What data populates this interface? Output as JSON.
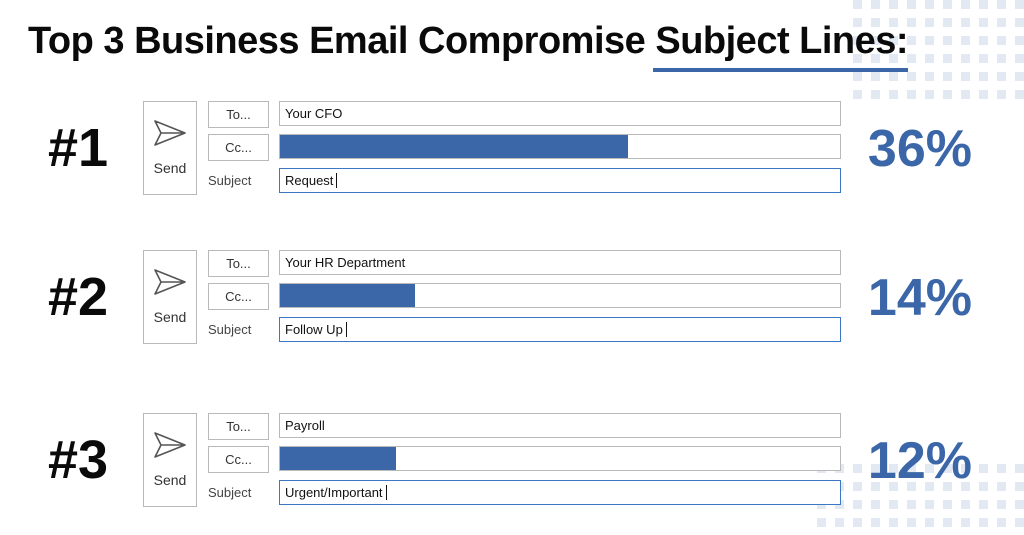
{
  "title": {
    "prefix": "Top 3 Business Email Compromise ",
    "underlined": "Subject Lines:"
  },
  "compose": {
    "send_label": "Send",
    "to_label": "To...",
    "cc_label": "Cc...",
    "subject_label": "Subject"
  },
  "colors": {
    "accent": "#3b67a8",
    "subject_border": "#3b79c4",
    "dots": "#e3e9f3"
  },
  "chart_data": {
    "type": "bar",
    "title": "Top 3 Business Email Compromise Subject Lines:",
    "categories": [
      "Request",
      "Follow Up",
      "Urgent/Important"
    ],
    "series": [
      {
        "values": [
          36,
          14,
          12
        ]
      }
    ],
    "ylim": [
      0,
      58
    ]
  },
  "rows": [
    {
      "rank": "#1",
      "to": "Your CFO",
      "subject": "Request",
      "percent_label": "36%",
      "percent": 36
    },
    {
      "rank": "#2",
      "to": "Your HR Department",
      "subject": "Follow Up",
      "percent_label": "14%",
      "percent": 14
    },
    {
      "rank": "#3",
      "to": "Payroll",
      "subject": "Urgent/Important",
      "percent_label": "12%",
      "percent": 12
    }
  ]
}
